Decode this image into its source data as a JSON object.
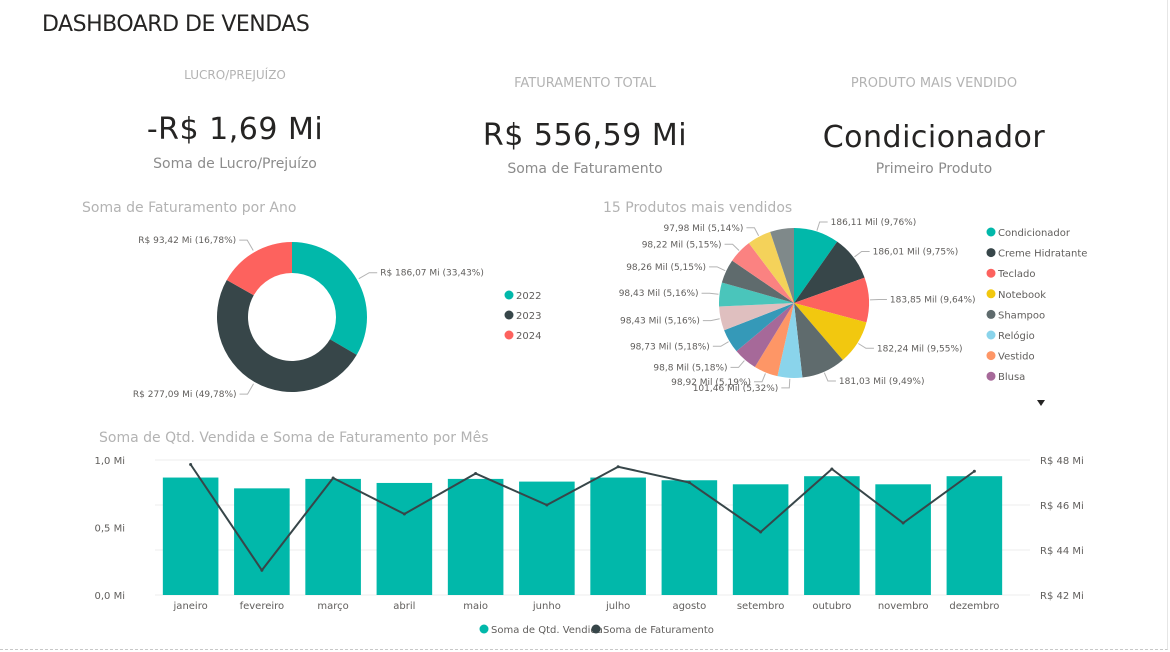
{
  "page": {
    "title": "DASHBOARD DE VENDAS"
  },
  "kpis": [
    {
      "caption": "LUCRO/PREJUÍZO",
      "value": "-R$ 1,69 Mi",
      "subtitle": "Soma de Lucro/Prejuízo"
    },
    {
      "caption": "FATURAMENTO TOTAL",
      "value": "R$ 556,59 Mi",
      "subtitle": "Soma de Faturamento"
    },
    {
      "caption": "PRODUTO MAIS VENDIDO",
      "value": "Condicionador",
      "subtitle": "Primeiro Produto"
    }
  ],
  "colors": {
    "teal": "#01b8aa",
    "dark": "#374649",
    "red": "#fd625e",
    "yellow": "#f2c80f",
    "gray": "#5f6b6d",
    "lightblue": "#8ad4eb",
    "orange": "#fe9666",
    "purple": "#a66999",
    "blue": "#3599b8",
    "pink": "#dfbfbf",
    "aqua": "#4ac5bb",
    "darkgray": "#5f6b6d",
    "salmon": "#fb8281",
    "gold": "#f4d25a",
    "slate": "#7f898a"
  },
  "chart_data": [
    {
      "type": "pie",
      "variant": "donut",
      "title": "Soma de Faturamento por Ano",
      "series": [
        {
          "name": "2022",
          "value": 186.07,
          "label": "R$ 186,07 Mi (33,43%)",
          "color": "#01b8aa"
        },
        {
          "name": "2023",
          "value": 277.09,
          "label": "R$ 277,09 Mi (49,78%)",
          "color": "#374649"
        },
        {
          "name": "2024",
          "value": 93.42,
          "label": "R$ 93,42 Mi (16,78%)",
          "color": "#fd625e"
        }
      ],
      "legend": [
        "2022",
        "2023",
        "2024"
      ],
      "legend_position": "right"
    },
    {
      "type": "pie",
      "title": "15 Produtos mais vendidos",
      "series": [
        {
          "name": "Condicionador",
          "value": 186.11,
          "label": "186,11 Mil (9,76%)",
          "color": "#01b8aa"
        },
        {
          "name": "Creme Hidratante",
          "value": 186.01,
          "label": "186,01 Mil (9,75%)",
          "color": "#374649"
        },
        {
          "name": "Teclado",
          "value": 183.85,
          "label": "183,85 Mil (9,64%)",
          "color": "#fd625e"
        },
        {
          "name": "Notebook",
          "value": 182.24,
          "label": "182,24 Mil (9,55%)",
          "color": "#f2c80f"
        },
        {
          "name": "Shampoo",
          "value": 181.03,
          "label": "181,03 Mil (9,49%)",
          "color": "#5f6b6d"
        },
        {
          "name": "Relógio",
          "value": 101.46,
          "label": "101,46 Mil (5,32%)",
          "color": "#8ad4eb"
        },
        {
          "name": "Vestido",
          "value": 98.92,
          "label": "98,92 Mil (5,19%)",
          "color": "#fe9666"
        },
        {
          "name": "Blusa",
          "value": 98.8,
          "label": "98,8 Mil (5,18%)",
          "color": "#a66999"
        },
        {
          "name": "",
          "value": 98.73,
          "label": "98,73 Mil (5,18%)",
          "color": "#3599b8"
        },
        {
          "name": "",
          "value": 98.43,
          "label": "98,43 Mil (5,16%)",
          "color": "#dfbfbf"
        },
        {
          "name": "",
          "value": 98.43,
          "label": "98,43 Mil (5,16%)",
          "color": "#4ac5bb"
        },
        {
          "name": "",
          "value": 98.26,
          "label": "98,26 Mil (5,15%)",
          "color": "#5f6b6d"
        },
        {
          "name": "",
          "value": 98.22,
          "label": "98,22 Mil (5,15%)",
          "color": "#fb8281"
        },
        {
          "name": "",
          "value": 97.98,
          "label": "97,98 Mil (5,14%)",
          "color": "#f4d25a"
        },
        {
          "name": "",
          "value": 97.98,
          "label": "",
          "color": "#7f898a"
        }
      ],
      "legend": [
        "Condicionador",
        "Creme Hidratante",
        "Teclado",
        "Notebook",
        "Shampoo",
        "Relógio",
        "Vestido",
        "Blusa"
      ],
      "legend_position": "right"
    },
    {
      "type": "bar",
      "title": "Soma de Qtd. Vendida e Soma de Faturamento por Mês",
      "categories": [
        "janeiro",
        "fevereiro",
        "março",
        "abril",
        "maio",
        "junho",
        "julho",
        "agosto",
        "setembro",
        "outubro",
        "novembro",
        "dezembro"
      ],
      "series": [
        {
          "name": "Soma de Qtd. Vendida",
          "kind": "bar",
          "axis": "left",
          "color": "#01b8aa",
          "values": [
            0.87,
            0.79,
            0.86,
            0.83,
            0.86,
            0.84,
            0.87,
            0.85,
            0.82,
            0.88,
            0.82,
            0.88
          ]
        },
        {
          "name": "Soma de Faturamento",
          "kind": "line",
          "axis": "right",
          "color": "#374649",
          "values": [
            47.8,
            43.1,
            47.2,
            45.6,
            47.4,
            46.0,
            47.7,
            47.0,
            44.8,
            47.6,
            45.2,
            47.5
          ]
        }
      ],
      "y_left": {
        "range": [
          0,
          1.0
        ],
        "ticks": [
          "0,0 Mi",
          "0,5 Mi",
          "1,0 Mi"
        ]
      },
      "y_right": {
        "range": [
          42,
          48
        ],
        "ticks": [
          "R$ 42 Mi",
          "R$ 44 Mi",
          "R$ 46 Mi",
          "R$ 48 Mi"
        ]
      },
      "legend": [
        "Soma de Qtd. Vendida",
        "Soma de Faturamento"
      ],
      "legend_position": "bottom",
      "grid": true
    }
  ]
}
